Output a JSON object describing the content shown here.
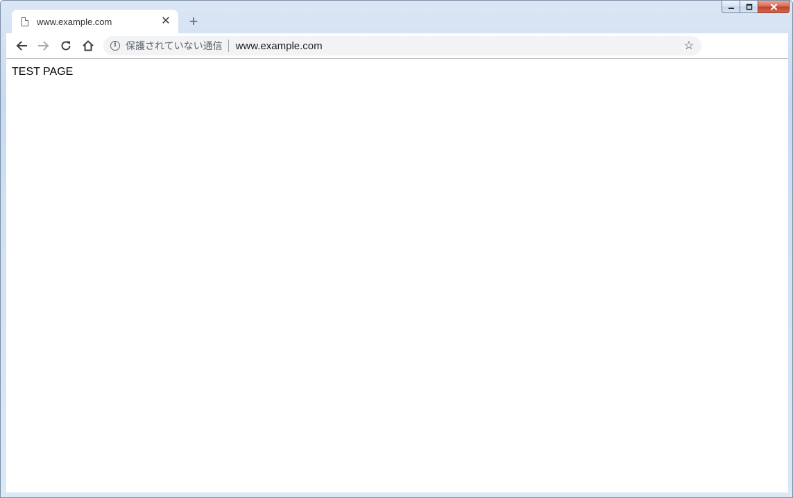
{
  "window": {
    "controls": {
      "minimize_icon": "minimize-icon",
      "maximize_icon": "maximize-icon",
      "close_icon": "close-icon",
      "close_color": "#c4412a"
    }
  },
  "tabs": [
    {
      "title": "www.example.com",
      "favicon": "page-icon",
      "close_glyph": "✕",
      "active": true
    }
  ],
  "new_tab_glyph": "+",
  "toolbar": {
    "back_icon": "arrow-left-icon",
    "forward_icon": "arrow-right-icon",
    "reload_icon": "reload-icon",
    "home_icon": "home-icon"
  },
  "omnibox": {
    "info_glyph": "i",
    "security_label": "保護されていない通信",
    "url": "www.example.com",
    "star_glyph": "☆"
  },
  "page": {
    "text": "TEST PAGE"
  }
}
